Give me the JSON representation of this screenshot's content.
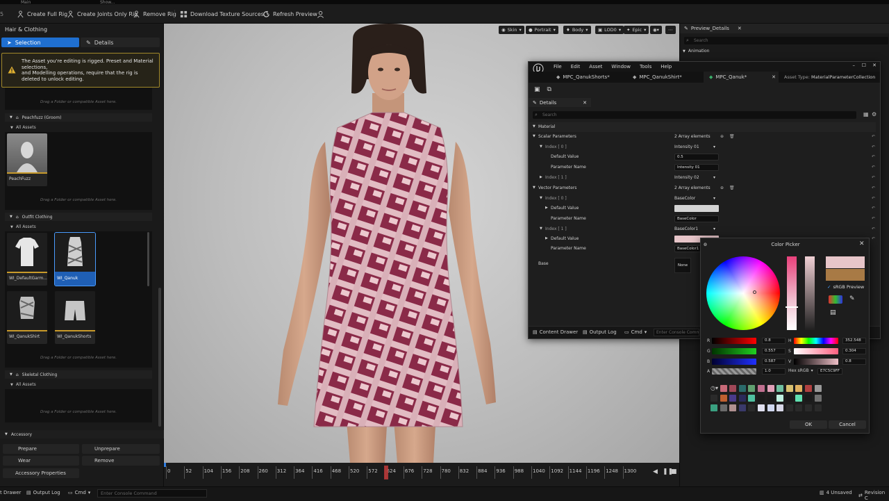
{
  "top_tabs": [
    "Main",
    "Show..."
  ],
  "toolbar": {
    "create_full_rig": "Create Full Rig",
    "create_joints_only_rig": "Create Joints Only Rig",
    "remove_rig": "Remove Rig",
    "download_texture_sources": "Download Texture Sources",
    "refresh_preview": "Refresh Preview"
  },
  "left": {
    "title": "Hair & Clothing",
    "tab_selection": "Selection",
    "tab_details": "Details",
    "warning_line1": "The Asset you're editing is rigged. Preset and Material selections,",
    "warning_line2": "and Modelling operations, require that the rig is deleted to unlock editing.",
    "drop_text": "Drag a Folder or compatible Asset here.",
    "peachfuzz_section": "Peachfuzz (Groom)",
    "all_assets": "All Assets",
    "peachfuzz_item": "PeachFuzz",
    "outfit_section": "Outfit Clothing",
    "outfit_items": [
      "WI_DefaultGarm...",
      "WI_Qanuk",
      "WI_QanukShirt",
      "WI_QanukShorts"
    ],
    "skeletal_section": "Skeletal Clothing",
    "accessory_section": "Accessory",
    "acc_prepare": "Prepare",
    "acc_unprepare": "Unprepare",
    "acc_wear": "Wear",
    "acc_remove": "Remove",
    "acc_properties": "Accessory Properties"
  },
  "viewport_toolbar": {
    "skin": "Skin",
    "portrait": "Portrait",
    "body": "Body",
    "lod": "LOD0",
    "epic": "Epic"
  },
  "timeline": {
    "ticks": [
      "0",
      "52",
      "104",
      "156",
      "208",
      "260",
      "312",
      "364",
      "416",
      "468",
      "520",
      "572",
      "624",
      "676",
      "728",
      "780",
      "832",
      "884",
      "936",
      "988",
      "1040",
      "1092",
      "1144",
      "1196",
      "1248",
      "1300"
    ],
    "current": "624"
  },
  "bottombar": {
    "content_drawer": "t Drawer",
    "output_log": "Output Log",
    "cmd": "Cmd",
    "console_placeholder": "Enter Console Command",
    "unsaved": "4 Unsaved",
    "revision": "Revision C"
  },
  "right_panel": {
    "tab": "Preview_Details",
    "search_placeholder": "Search",
    "animation": "Animation"
  },
  "mpc": {
    "menu": [
      "File",
      "Edit",
      "Asset",
      "Window",
      "Tools",
      "Help"
    ],
    "tabs": [
      "MPC_QanukShorts*",
      "MPC_QanukShirt*",
      "MPC_Qanuk*"
    ],
    "asset_type_label": "Asset Type:",
    "asset_type_value": "MaterialParameterCollection",
    "details_tab": "Details",
    "search_placeholder": "Search",
    "material_section": "Material",
    "scalar_params": "Scalar Parameters",
    "scalar_count": "2 Array elements",
    "index0": "Index [ 0 ]",
    "index1": "Index [ 1 ]",
    "intensity01": "Intensity 01",
    "intensity02": "Intensity 02",
    "default_value": "Default Value",
    "default_value_num": "0.5",
    "parameter_name": "Parameter Name",
    "param_name_val": "Intensity 01",
    "vector_params": "Vector Parameters",
    "vector_count": "2 Array elements",
    "basecolor": "BaseColor",
    "basecolor1": "BaseColor1",
    "base_label": "Base",
    "none_label": "None",
    "content_drawer": "Content Drawer",
    "output_log": "Output Log",
    "cmd": "Cmd",
    "console_placeholder": "Enter Console Comm"
  },
  "color_picker": {
    "title": "Color Picker",
    "srgb_preview": "sRGB Preview",
    "r_val": "0.8",
    "g_val": "0.557",
    "b_val": "0.587",
    "a_val": "1.0",
    "h_val": "352.548",
    "s_val": "0.304",
    "v_val": "0.8",
    "r_label": "R",
    "g_label": "G",
    "b_label": "B",
    "a_label": "A",
    "h_label": "H",
    "s_label": "S",
    "v_label": "V",
    "hex_label": "Hex sRGB",
    "hex_val": "E7C5C9FF",
    "ok": "OK",
    "cancel": "Cancel",
    "new_color": "#E7C5C9",
    "old_color": "#A87A45"
  },
  "colors": {
    "accent_blue": "#1F5FB5",
    "warning": "#D9A62A",
    "dress_magenta": "#8A2A48",
    "strap_pink": "#E7C5C9"
  }
}
